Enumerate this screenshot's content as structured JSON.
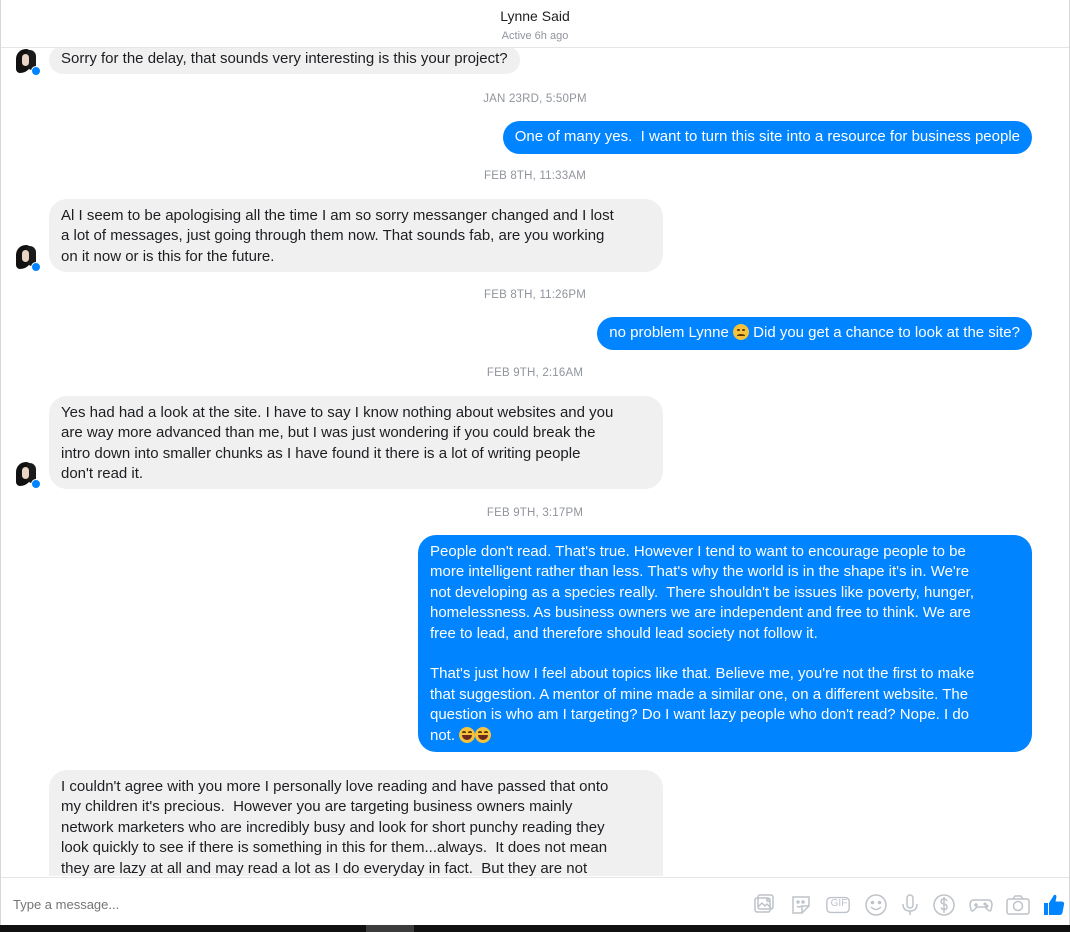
{
  "header": {
    "name": "Lynne Said",
    "status": "Active 6h ago"
  },
  "messages": [
    {
      "text": "Sorry for the delay, that sounds very interesting is this your project?"
    },
    {
      "text": "One of many yes.  I want to turn this site into a resource for business people"
    },
    {
      "text": "Al I seem to be apologising all the time I am so sorry messanger changed and I lost\na lot of messages, just going through them now. That sounds fab, are you working\non it now or is this for the future."
    },
    {
      "text_before": "no problem Lynne ",
      "emoji": "disappointed-face-emoji",
      "text_after": " Did you get a chance to look at the site?"
    },
    {
      "text": "Yes had had a look at the site. I have to say I know nothing about websites and you\nare way more advanced than me, but I was just wondering if you could break the\nintro down into smaller chunks as I have found it there is a lot of writing people\ndon't read it."
    },
    {
      "text": "People don't read. That's true. However I tend to want to encourage people to be\nmore intelligent rather than less. That's why the world is in the shape it's in. We're\nnot developing as a species really.  There shouldn't be issues like poverty, hunger,\nhomelessness. As business owners we are independent and free to think. We are\nfree to lead, and therefore should lead society not follow it.\n\nThat's just how I feel about topics like that. Believe me, you're not the first to make\nthat suggestion. A mentor of mine made a similar one, on a different website. The\nquestion is who am I targeting? Do I want lazy people who don't read? Nope. I do\nnot. ",
      "emoji": "grinning-squinting-face-emoji"
    },
    {
      "text": "I couldn't agree with you more I personally love reading and have passed that onto\nmy children it's precious.  However you are targeting business owners mainly\nnetwork marketers who are incredibly busy and look for short punchy reading they\nlook quickly to see if there is something in this for them...always.  It does not mean\nthey are lazy at all and may read a lot as I do everyday in fact.  But they are not"
    }
  ],
  "timestamps": [
    "JAN 23RD, 5:50PM",
    "FEB 8TH, 11:33AM",
    "FEB 8TH, 11:26PM",
    "FEB 9TH, 2:16AM",
    "FEB 9TH, 3:17PM"
  ],
  "composer": {
    "placeholder": "Type a message...",
    "tools": [
      "image-icon",
      "sticker-icon",
      "gif-icon",
      "emoji-icon",
      "microphone-icon",
      "payment-icon",
      "game-icon",
      "camera-icon",
      "like-icon"
    ],
    "gif_label": "GIF",
    "like_color": "#0084ff"
  },
  "colors": {
    "outgoing": "#0084ff",
    "incoming": "#f1f0f0"
  }
}
